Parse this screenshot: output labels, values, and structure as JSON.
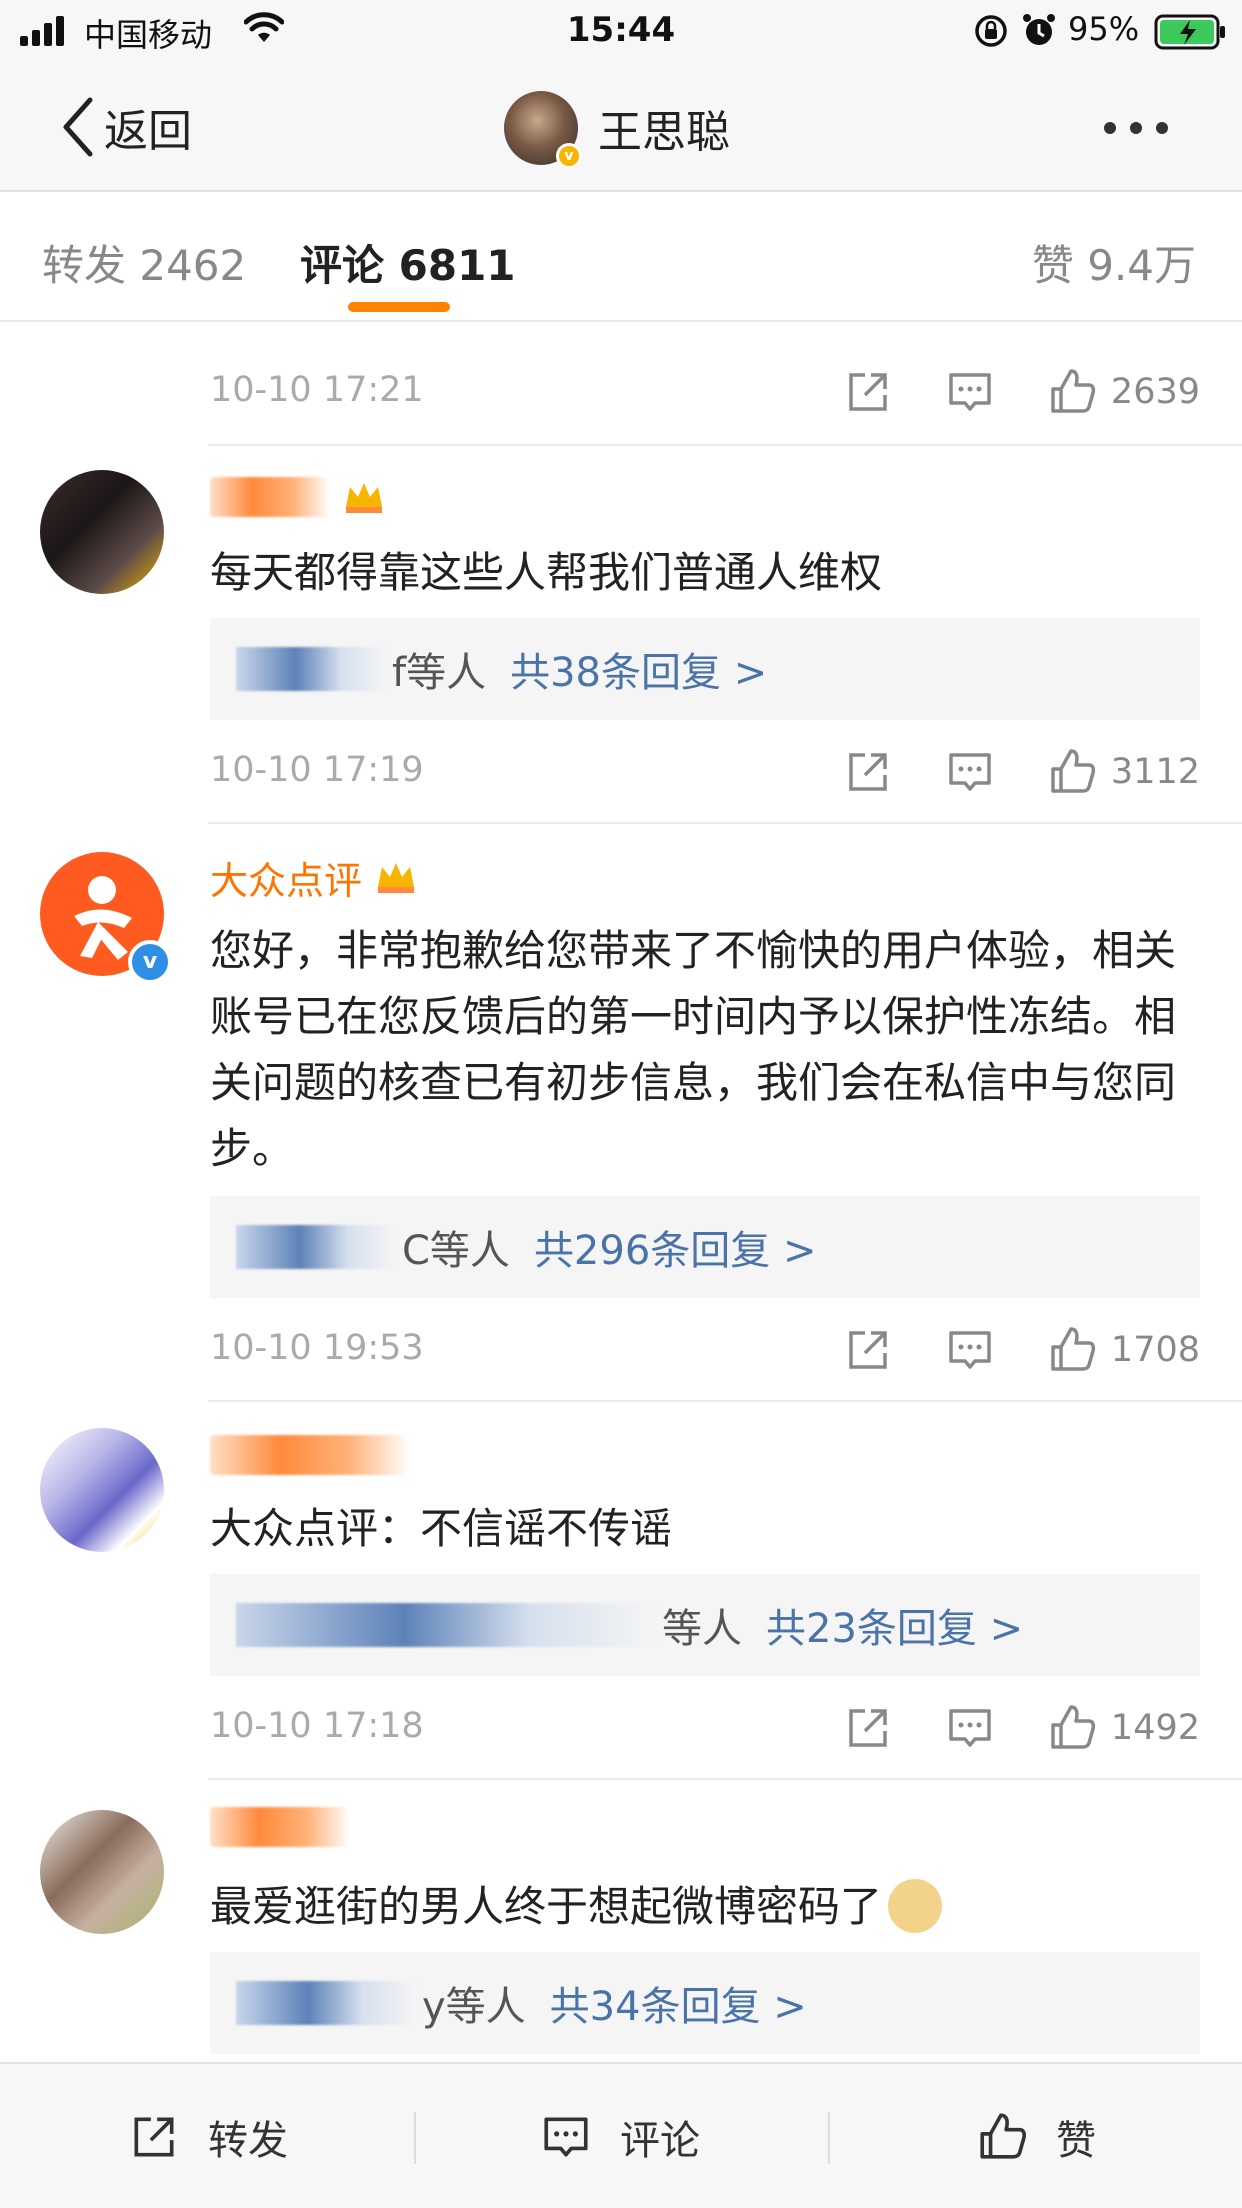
{
  "status_bar": {
    "carrier": "中国移动",
    "time": "15:44",
    "battery": "95%"
  },
  "nav": {
    "back_label": "返回",
    "title": "王思聪"
  },
  "tabs": {
    "repost": "转发 2462",
    "comments": "评论 6811",
    "likes": "赞 9.4万",
    "accent_color": "#ff8200"
  },
  "comments": [
    {
      "time": "10-10 17:21",
      "likes": "2639"
    },
    {
      "text": "每天都得靠这些人帮我们普通人维权",
      "reply_people_suffix": "f等人",
      "reply_link": "共38条回复 >",
      "time": "10-10 17:19",
      "likes": "3112"
    },
    {
      "username": "大众点评",
      "text": "您好，非常抱歉给您带来了不愉快的用户体验，相关账号已在您反馈后的第一时间内予以保护性冻结。相关问题的核查已有初步信息，我们会在私信中与您同步。",
      "reply_people_suffix": "C等人",
      "reply_link": "共296条回复 >",
      "time": "10-10 19:53",
      "likes": "1708"
    },
    {
      "text": "大众点评：不信谣不传谣",
      "reply_people_suffix": "等人",
      "reply_link": "共23条回复 >",
      "time": "10-10 17:18",
      "likes": "1492"
    },
    {
      "text": "最爱逛街的男人终于想起微博密码了",
      "reply_people_suffix": "y等人",
      "reply_link": "共34条回复 >"
    }
  ],
  "bottom_bar": {
    "repost": "转发",
    "comment": "评论",
    "like": "赞"
  },
  "colors": {
    "link_blue": "#4a73a8",
    "brand_orange": "#ff7300"
  }
}
